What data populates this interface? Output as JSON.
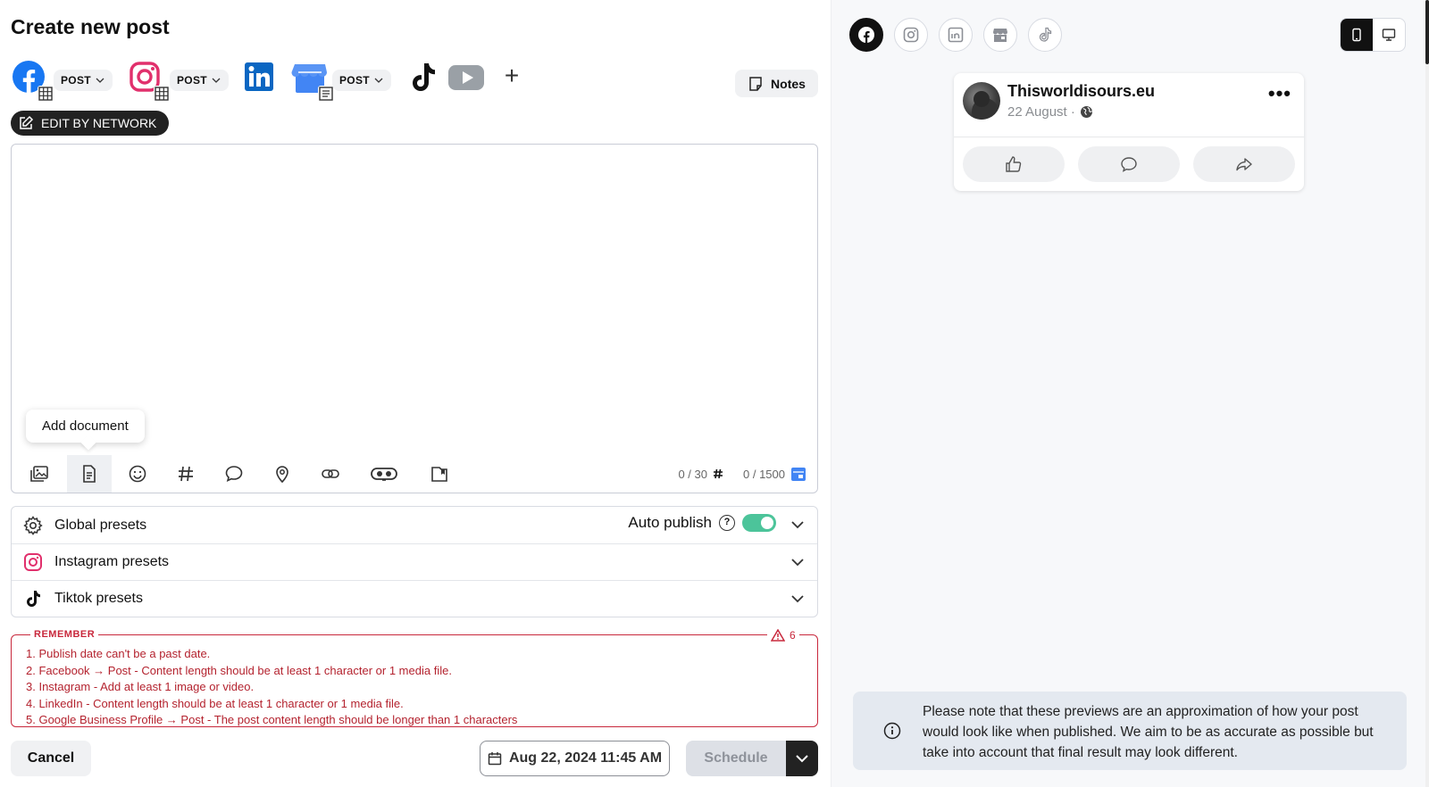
{
  "page_title": "Create new post",
  "networks": {
    "post_pill": "POST",
    "plus": "+",
    "notes": "Notes",
    "edit_by_network": "EDIT BY NETWORK"
  },
  "editor": {
    "tooltip": "Add document",
    "hashtag_count": "0 / 30",
    "char_count": "0 / 1500"
  },
  "presets": {
    "global": "Global presets",
    "auto_publish": "Auto publish",
    "auto_publish_on": true,
    "instagram": "Instagram presets",
    "tiktok": "Tiktok presets"
  },
  "remember": {
    "title": "REMEMBER",
    "count": "6",
    "items": [
      "1. Publish date can't be a past date.",
      "2. Facebook → Post - Content length should be at least 1 character or 1 media file.",
      "3. Instagram - Add at least 1 image or video.",
      "4. LinkedIn - Content length should be at least 1 character or 1 media file.",
      "5. Google Business Profile → Post - The post content length should be longer than 1 characters"
    ]
  },
  "footer": {
    "cancel": "Cancel",
    "date": "Aug 22, 2024 11:45 AM",
    "schedule": "Schedule"
  },
  "preview": {
    "page_name": "Thisworldisours.eu",
    "date": "22 August ·",
    "more": "•••",
    "note": "Please note that these previews are an approximation of how your post would look like when published. We aim to be as accurate as possible but take into account that final result may look different."
  },
  "colors": {
    "facebook": "#1877F2",
    "instagram": "#E1306C",
    "linkedin": "#0A66C2",
    "gbp": "#4285F4",
    "youtube": "#9aa0a6",
    "error": "#C8283C",
    "toggle": "#4CC49A"
  }
}
